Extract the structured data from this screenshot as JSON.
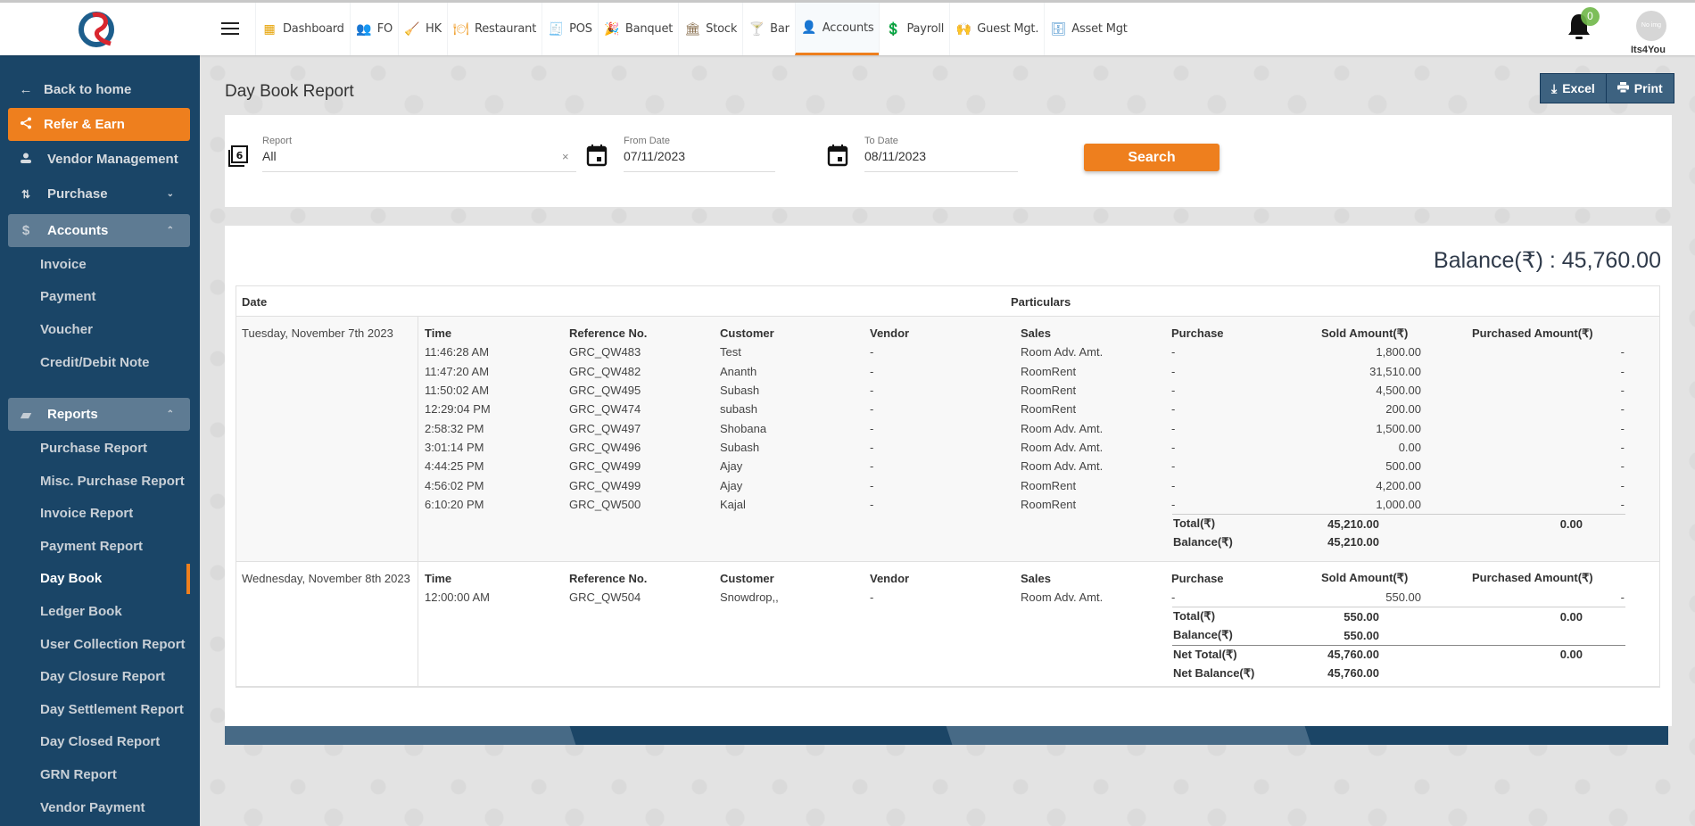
{
  "header": {
    "modules": [
      {
        "label": "Dashboard",
        "icon": "dashboard-icon",
        "active": false
      },
      {
        "label": "FO",
        "icon": "front-office-icon",
        "active": false
      },
      {
        "label": "HK",
        "icon": "housekeeping-icon",
        "active": false
      },
      {
        "label": "Restaurant",
        "icon": "restaurant-icon",
        "active": false
      },
      {
        "label": "POS",
        "icon": "pos-icon",
        "active": false
      },
      {
        "label": "Banquet",
        "icon": "banquet-icon",
        "active": false
      },
      {
        "label": "Stock",
        "icon": "stock-icon",
        "active": false
      },
      {
        "label": "Bar",
        "icon": "bar-icon",
        "active": false
      },
      {
        "label": "Accounts",
        "icon": "accounts-icon",
        "active": true
      },
      {
        "label": "Payroll",
        "icon": "payroll-icon",
        "active": false
      },
      {
        "label": "Guest Mgt.",
        "icon": "guest-icon",
        "active": false
      },
      {
        "label": "Asset Mgt",
        "icon": "asset-icon",
        "active": false
      }
    ],
    "notification_count": "0",
    "avatar_text": "No img",
    "username": "Its4You"
  },
  "sidebar": {
    "back_label": "Back to home",
    "refer_label": "Refer & Earn",
    "vendor_label": "Vendor Management",
    "purchase_label": "Purchase",
    "accounts_label": "Accounts",
    "accounts_items": [
      "Invoice",
      "Payment",
      "Voucher",
      "Credit/Debit Note"
    ],
    "reports_label": "Reports",
    "reports_items": [
      "Purchase Report",
      "Misc. Purchase Report",
      "Invoice Report",
      "Payment Report",
      "Day Book",
      "Ledger Book",
      "User Collection Report",
      "Day Closure Report",
      "Day Settlement Report",
      "Day Closed Report",
      "GRN Report",
      "Vendor Payment"
    ],
    "active_item": "Day Book"
  },
  "page": {
    "title": "Day Book Report",
    "excel_label": "Excel",
    "print_label": "Print"
  },
  "filters": {
    "report_label": "Report",
    "report_value": "All",
    "from_label": "From Date",
    "from_value": "07/11/2023",
    "to_label": "To Date",
    "to_value": "08/11/2023",
    "search_label": "Search"
  },
  "report": {
    "balance_text": "Balance(₹) : 45,760.00",
    "col_date": "Date",
    "col_particulars": "Particulars",
    "detail_headers": [
      "Time",
      "Reference No.",
      "Customer",
      "Vendor",
      "Sales",
      "Purchase",
      "Sold Amount(₹)",
      "Purchased Amount(₹)"
    ],
    "groups": [
      {
        "date": "Tuesday, November 7th 2023",
        "rows": [
          [
            "11:46:28 AM",
            "GRC_QW483",
            "Test",
            "-",
            "Room Adv. Amt.",
            "-",
            "1,800.00",
            "-"
          ],
          [
            "11:47:20 AM",
            "GRC_QW482",
            "Ananth",
            "-",
            "RoomRent",
            "-",
            "31,510.00",
            "-"
          ],
          [
            "11:50:02 AM",
            "GRC_QW495",
            "Subash",
            "-",
            "RoomRent",
            "-",
            "4,500.00",
            "-"
          ],
          [
            "12:29:04 PM",
            "GRC_QW474",
            "subash",
            "-",
            "RoomRent",
            "-",
            "200.00",
            "-"
          ],
          [
            "2:58:32 PM",
            "GRC_QW497",
            "Shobana",
            "-",
            "Room Adv. Amt.",
            "-",
            "1,500.00",
            "-"
          ],
          [
            "3:01:14 PM",
            "GRC_QW496",
            "Subash",
            "-",
            "Room Adv. Amt.",
            "-",
            "0.00",
            "-"
          ],
          [
            "4:44:25 PM",
            "GRC_QW499",
            "Ajay",
            "-",
            "Room Adv. Amt.",
            "-",
            "500.00",
            "-"
          ],
          [
            "4:56:02 PM",
            "GRC_QW499",
            "Ajay",
            "-",
            "RoomRent",
            "-",
            "4,200.00",
            "-"
          ],
          [
            "6:10:20 PM",
            "GRC_QW500",
            "Kajal",
            "-",
            "RoomRent",
            "-",
            "1,000.00",
            "-"
          ]
        ],
        "total_label": "Total(₹)",
        "total_sold": "45,210.00",
        "total_purchased": "0.00",
        "balance_label": "Balance(₹)",
        "balance": "45,210.00"
      },
      {
        "date": "Wednesday, November 8th 2023",
        "rows": [
          [
            "12:00:00 AM",
            "GRC_QW504",
            "Snowdrop,,",
            "-",
            "Room Adv. Amt.",
            "-",
            "550.00",
            "-"
          ]
        ],
        "total_label": "Total(₹)",
        "total_sold": "550.00",
        "total_purchased": "0.00",
        "balance_label": "Balance(₹)",
        "balance": "550.00"
      }
    ],
    "net_total_label": "Net Total(₹)",
    "net_total_sold": "45,760.00",
    "net_total_purchased": "0.00",
    "net_balance_label": "Net Balance(₹)",
    "net_balance": "45,760.00"
  },
  "colors": {
    "sidebar_bg": "#1a4567",
    "accent_orange": "#ee7f1e",
    "action_button": "#3d6280"
  }
}
